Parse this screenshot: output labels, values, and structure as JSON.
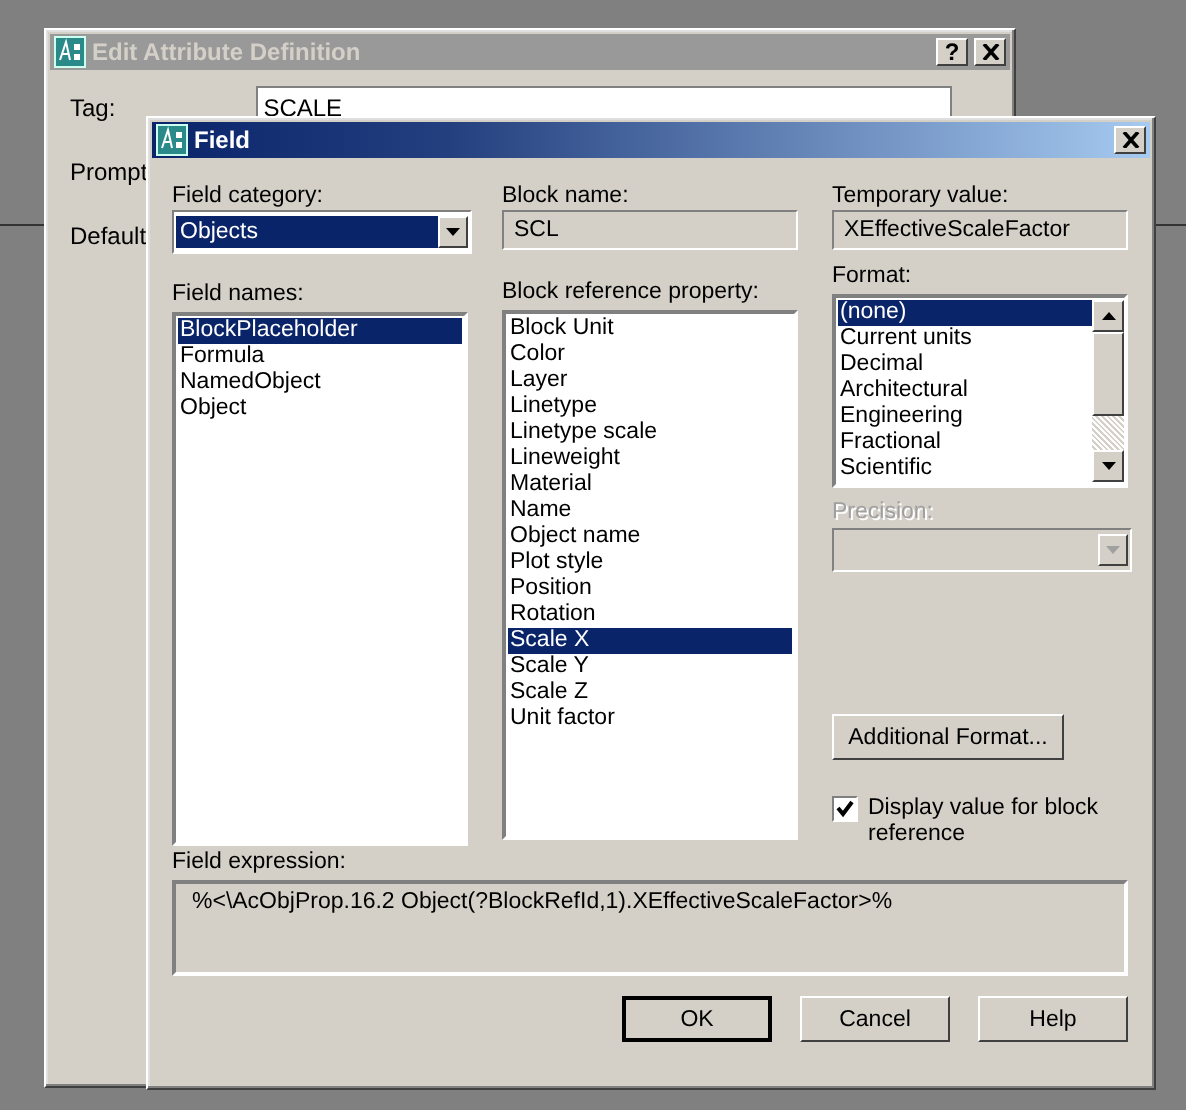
{
  "background_window": {
    "title": "Edit Attribute Definition",
    "help_button": "?",
    "labels": [
      "Tag:",
      "Prompt",
      "Default"
    ],
    "tag_value": "SCALE"
  },
  "dialog": {
    "title": "Field",
    "field_category": {
      "label": "Field category:",
      "value": "Objects"
    },
    "field_names": {
      "label": "Field names:",
      "items": [
        {
          "label": "BlockPlaceholder",
          "selected": true
        },
        {
          "label": "Formula",
          "selected": false
        },
        {
          "label": "NamedObject",
          "selected": false
        },
        {
          "label": "Object",
          "selected": false
        }
      ]
    },
    "block_name": {
      "label": "Block name:",
      "value": "SCL"
    },
    "block_reference_property": {
      "label": "Block reference property:",
      "items": [
        {
          "label": "Block Unit",
          "selected": false
        },
        {
          "label": "Color",
          "selected": false
        },
        {
          "label": "Layer",
          "selected": false
        },
        {
          "label": "Linetype",
          "selected": false
        },
        {
          "label": "Linetype scale",
          "selected": false
        },
        {
          "label": "Lineweight",
          "selected": false
        },
        {
          "label": "Material",
          "selected": false
        },
        {
          "label": "Name",
          "selected": false
        },
        {
          "label": "Object name",
          "selected": false
        },
        {
          "label": "Plot style",
          "selected": false
        },
        {
          "label": "Position",
          "selected": false
        },
        {
          "label": "Rotation",
          "selected": false
        },
        {
          "label": "Scale X",
          "selected": true
        },
        {
          "label": "Scale Y",
          "selected": false
        },
        {
          "label": "Scale Z",
          "selected": false
        },
        {
          "label": "Unit factor",
          "selected": false
        }
      ]
    },
    "temporary_value": {
      "label": "Temporary value:",
      "value": "XEffectiveScaleFactor"
    },
    "format": {
      "label": "Format:",
      "items": [
        {
          "label": "(none)",
          "selected": true
        },
        {
          "label": "Current units",
          "selected": false
        },
        {
          "label": "Decimal",
          "selected": false
        },
        {
          "label": "Architectural",
          "selected": false
        },
        {
          "label": "Engineering",
          "selected": false
        },
        {
          "label": "Fractional",
          "selected": false
        },
        {
          "label": "Scientific",
          "selected": false
        }
      ]
    },
    "precision": {
      "label": "Precision:",
      "disabled": true
    },
    "additional_format_button": "Additional Format...",
    "display_value": {
      "label": "Display value for block reference",
      "checked": true
    },
    "field_expression": {
      "label": "Field expression:",
      "value": "%<\\AcObjProp.16.2 Object(?BlockRefId,1).XEffectiveScaleFactor>%"
    },
    "buttons": [
      {
        "label": "OK",
        "default": true
      },
      {
        "label": "Cancel",
        "default": false
      },
      {
        "label": "Help",
        "default": false
      }
    ]
  }
}
